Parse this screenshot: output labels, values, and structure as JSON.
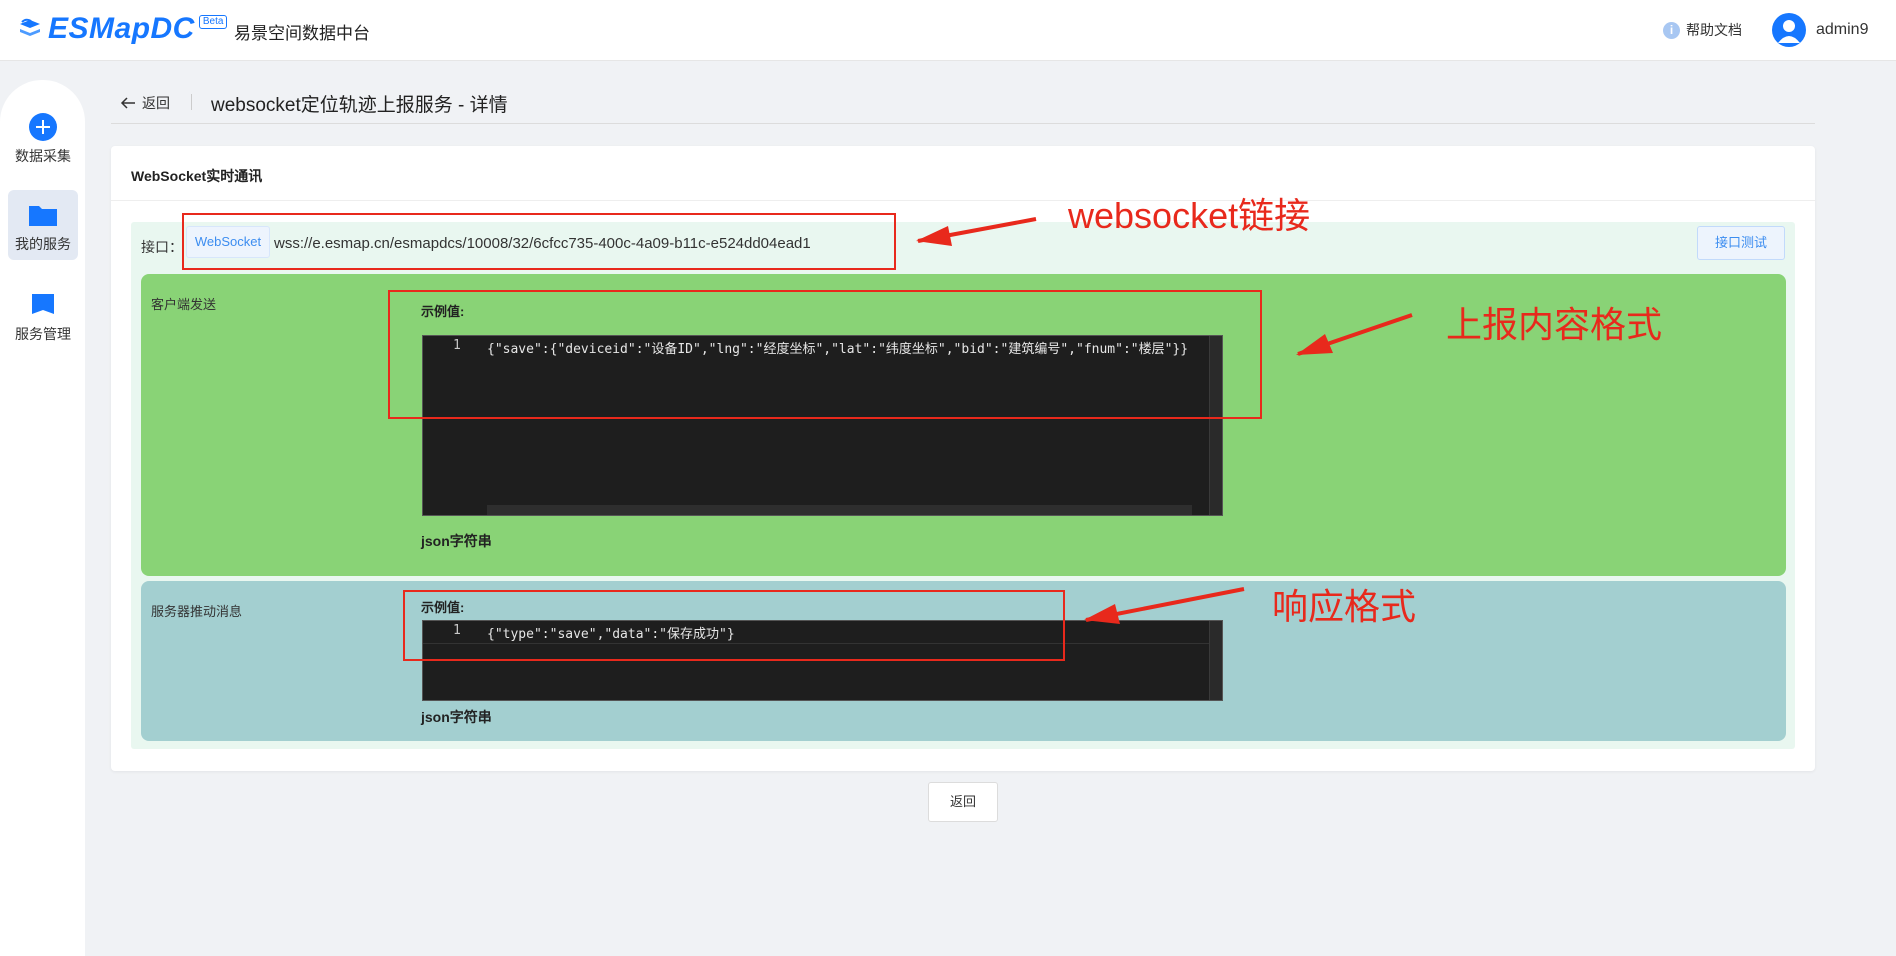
{
  "header": {
    "logo_text": "ESMapDC",
    "beta": "Beta",
    "platform_name": "易景空间数据中台",
    "help_icon": "i",
    "help_label": "帮助文档",
    "username": "admin9"
  },
  "sidebar": {
    "items": [
      {
        "label": "数据采集",
        "icon": "plus-circle-icon"
      },
      {
        "label": "我的服务",
        "icon": "folder-icon"
      },
      {
        "label": "服务管理",
        "icon": "bookmark-icon"
      }
    ]
  },
  "page": {
    "back_label": "返回",
    "title": "websocket定位轨迹上报服务 - 详情"
  },
  "card": {
    "title": "WebSocket实时通讯",
    "interface_label": "接口：",
    "protocol_tag": "WebSocket",
    "url": "wss://e.esmap.cn/esmapdcs/10008/32/6cfcc735-400c-4a09-b11c-e524dd04ead1",
    "test_button": "接口测试",
    "client_section": {
      "label": "客户端发送",
      "example_label": "示例值:",
      "line_number": "1",
      "code": "{\"save\":{\"deviceid\":\"设备ID\",\"lng\":\"经度坐标\",\"lat\":\"纬度坐标\",\"bid\":\"建筑编号\",\"fnum\":\"楼层\"}}",
      "format_label": "json字符串"
    },
    "server_section": {
      "label": "服务器推动消息",
      "example_label": "示例值:",
      "line_number": "1",
      "code": "{\"type\":\"save\",\"data\":\"保存成功\"}",
      "format_label": "json字符串"
    }
  },
  "footer": {
    "back_button": "返回"
  },
  "annotations": {
    "websocket_link": "websocket链接",
    "report_format": "上报内容格式",
    "response_format": "响应格式",
    "color": "#e8291c"
  },
  "colors": {
    "brand": "#1677ff",
    "client_section_bg": "#89d376",
    "server_section_bg": "#a3cfd0",
    "panel_bg": "#e9f7f0",
    "code_bg": "#1e1e1e"
  }
}
